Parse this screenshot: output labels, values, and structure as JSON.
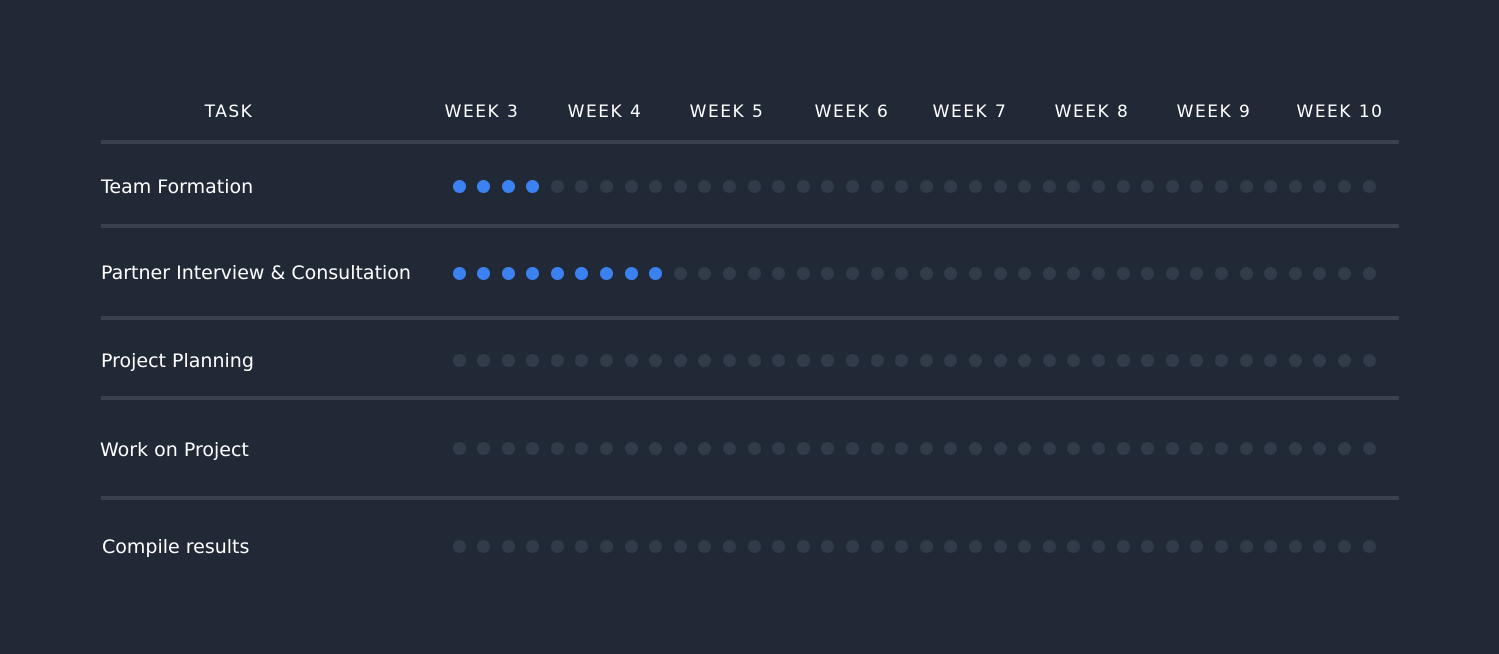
{
  "header": {
    "task_label": "TASK",
    "weeks": [
      "WEEK 3",
      "WEEK 4",
      "WEEK 5",
      "WEEK 6",
      "WEEK 7",
      "WEEK 8",
      "WEEK 9",
      "WEEK 10"
    ]
  },
  "tasks": [
    {
      "label": "Team Formation",
      "progress_dots": 4,
      "total_dots": 38
    },
    {
      "label": "Partner Interview & Consultation",
      "progress_dots": 9,
      "total_dots": 38
    },
    {
      "label": "Project Planning",
      "progress_dots": 0,
      "total_dots": 38
    },
    {
      "label": "Work on Project",
      "progress_dots": 0,
      "total_dots": 38
    },
    {
      "label": "Compile results",
      "progress_dots": 0,
      "total_dots": 38
    }
  ],
  "colors": {
    "background": "#212937",
    "dot_active": "#3b82f0",
    "dot_inactive": "#323b49",
    "divider": "#3a4250",
    "text": "#ffffff"
  }
}
